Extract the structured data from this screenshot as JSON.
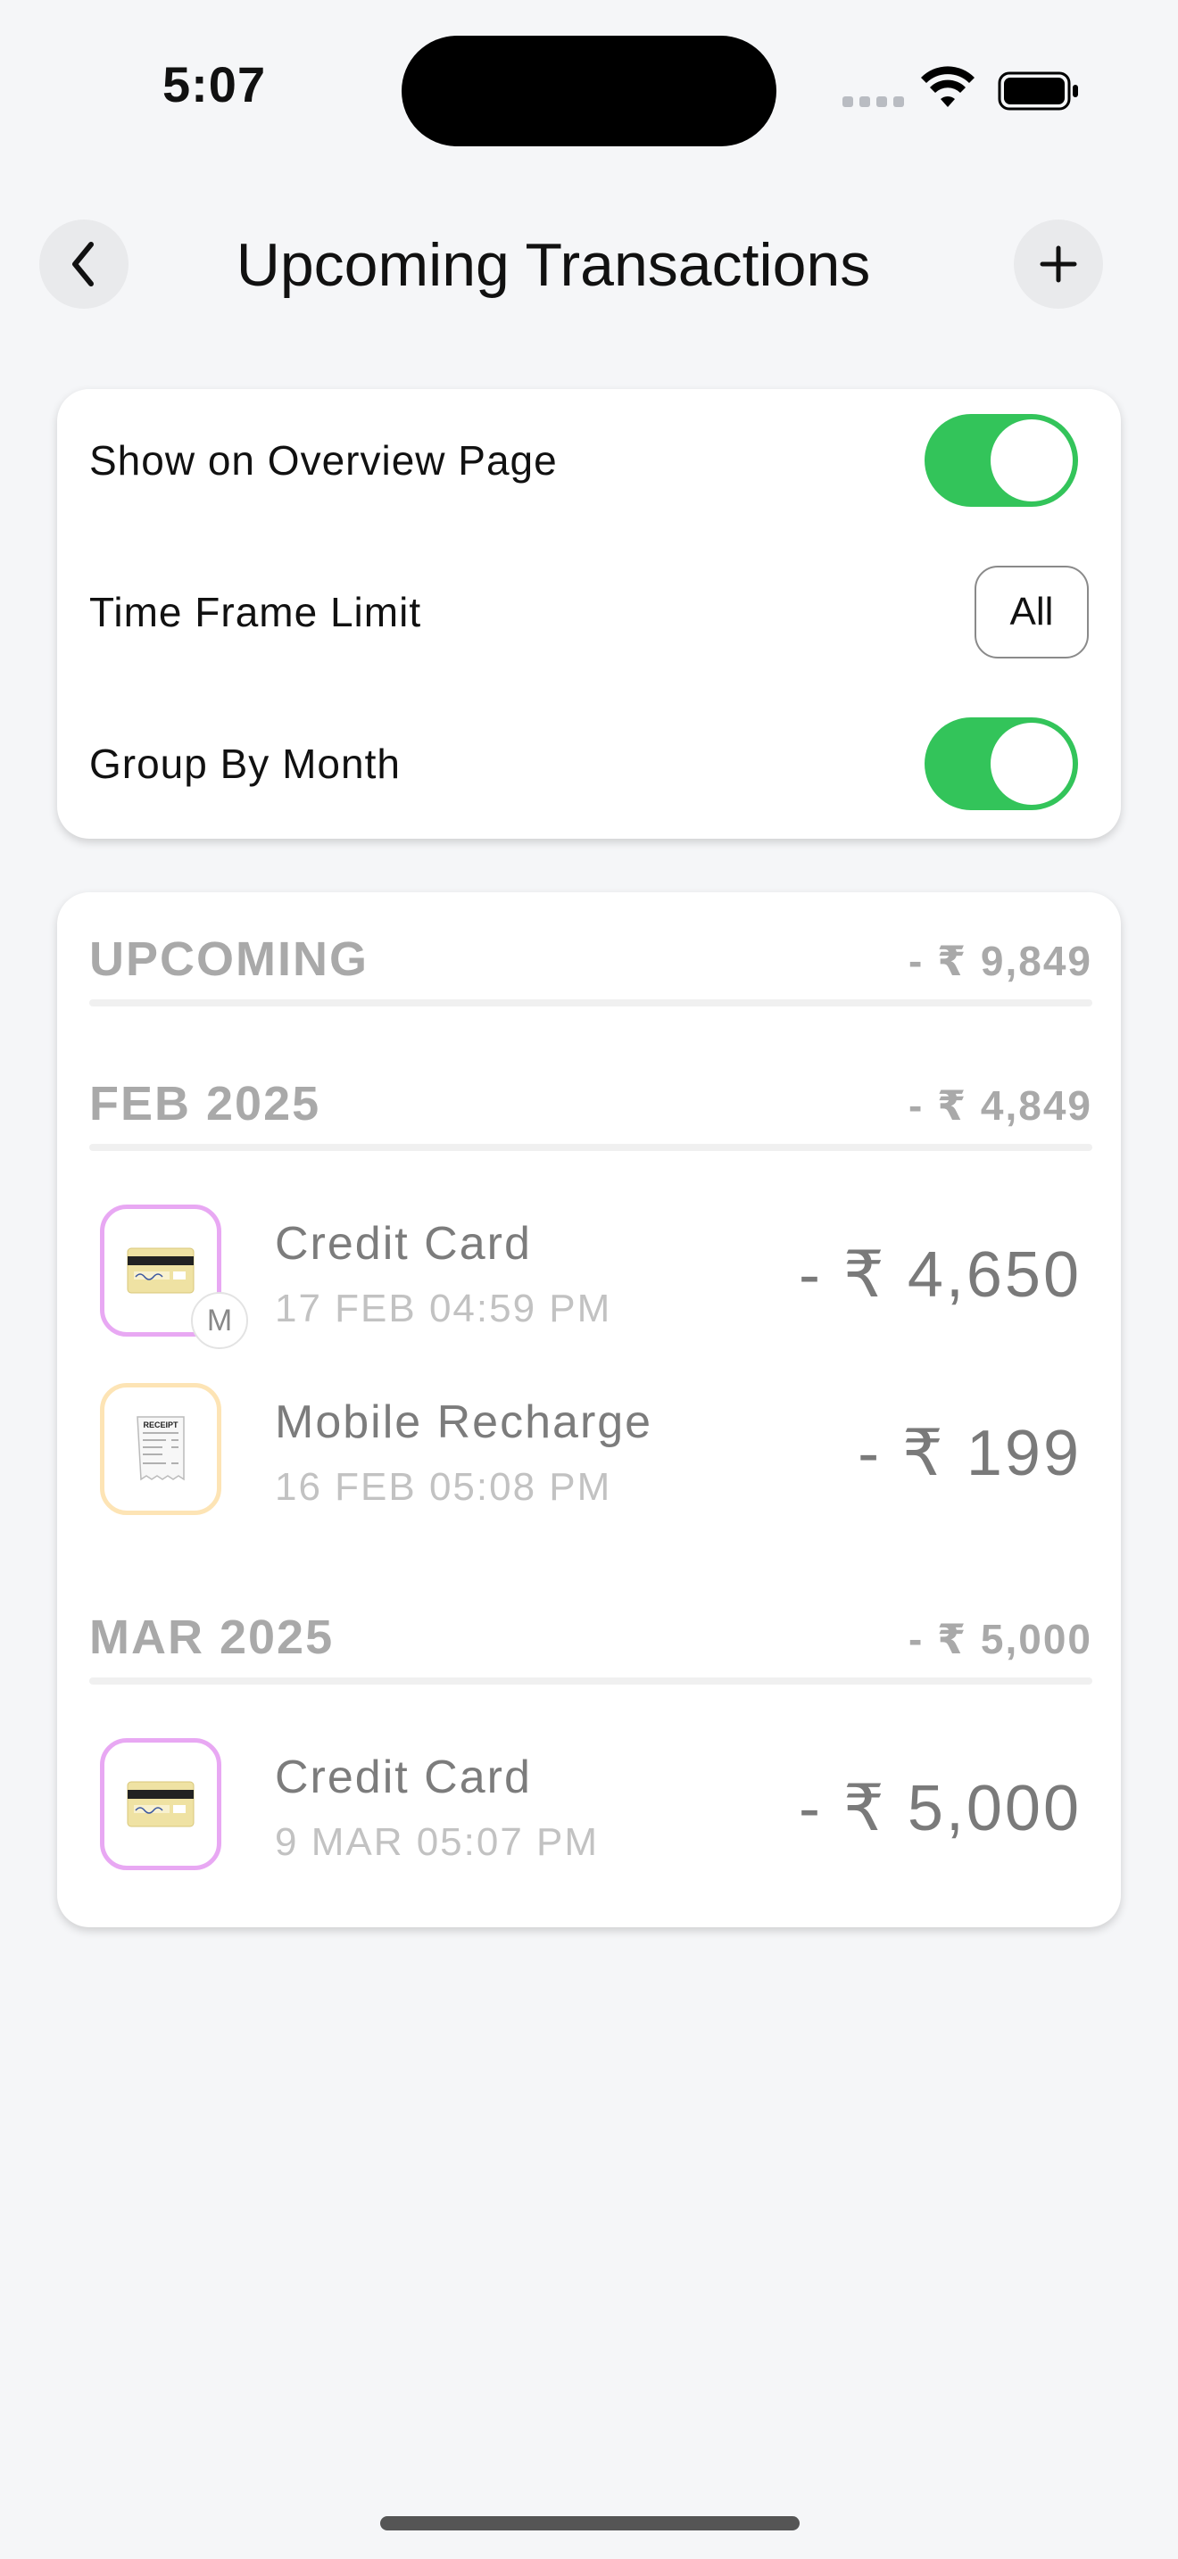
{
  "status_bar": {
    "time": "5:07"
  },
  "header": {
    "title": "Upcoming Transactions",
    "back_icon": "chevron-left-icon",
    "add_icon": "plus-icon"
  },
  "settings": {
    "show_on_overview": {
      "label": "Show on Overview Page",
      "on": true
    },
    "time_frame_limit": {
      "label": "Time Frame Limit",
      "value": "All"
    },
    "group_by_month": {
      "label": "Group By Month",
      "on": true
    }
  },
  "colors": {
    "toggle_on": "#33c45a",
    "card_icon_border": "#e8a8f3",
    "receipt_icon_border": "#fde4b5"
  },
  "list": {
    "upcoming": {
      "label": "UPCOMING",
      "total": "- ₹ 9,849"
    },
    "groups": [
      {
        "label": "FEB 2025",
        "total": "- ₹ 4,849",
        "items": [
          {
            "name": "Credit Card",
            "date": "17 FEB 04:59 PM",
            "amount": "- ₹ 4,650",
            "icon": "credit-card-icon",
            "badge": "M"
          },
          {
            "name": "Mobile Recharge",
            "date": "16 FEB 05:08 PM",
            "amount": "- ₹ 199",
            "icon": "receipt-icon",
            "receipt_text": "RECEIPT"
          }
        ]
      },
      {
        "label": "MAR 2025",
        "total": "- ₹ 5,000",
        "items": [
          {
            "name": "Credit Card",
            "date": "9 MAR 05:07 PM",
            "amount": "- ₹ 5,000",
            "icon": "credit-card-icon"
          }
        ]
      }
    ]
  }
}
